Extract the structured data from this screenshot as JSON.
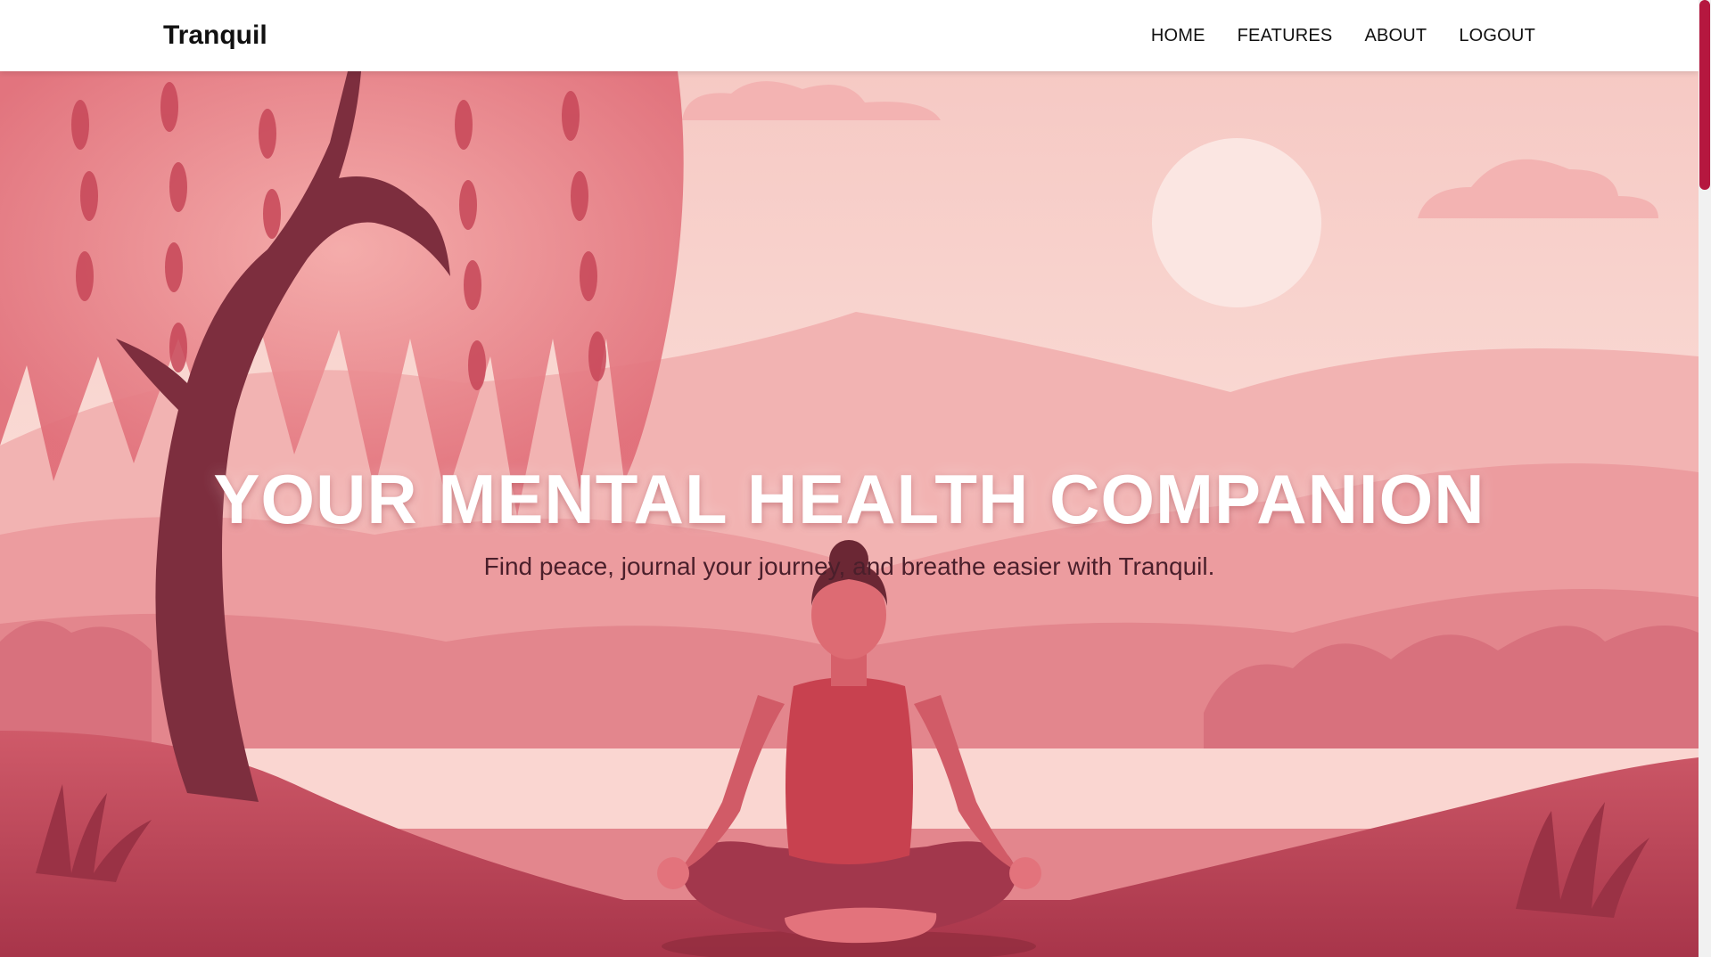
{
  "brand": {
    "name": "Tranquil"
  },
  "nav": {
    "items": [
      {
        "label": "HOME"
      },
      {
        "label": "FEATURES"
      },
      {
        "label": "ABOUT"
      },
      {
        "label": "LOGOUT"
      }
    ]
  },
  "hero": {
    "title": "YOUR MENTAL HEALTH COMPANION",
    "subtitle": "Find peace, journal your journey, and breathe easier with Tranquil.",
    "illustration": "meditating-woman-under-willow-tree-scene"
  },
  "colors": {
    "accent": "#b5173f",
    "nav_text": "#111111",
    "hero_title": "#ffffff",
    "hero_subtitle": "#4a1f2b",
    "sky": "#f8d3cf",
    "hill_dark": "#b8495a"
  }
}
